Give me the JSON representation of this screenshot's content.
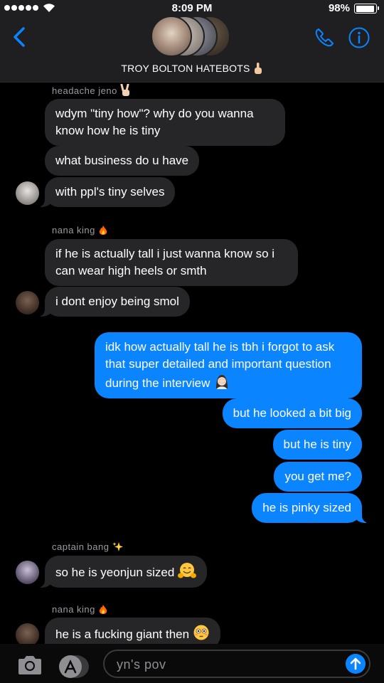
{
  "status_bar": {
    "time": "8:09 PM",
    "battery_text": "98%",
    "battery_level": 0.98
  },
  "header": {
    "group_name": "TROY BOLTON HATEBOTS",
    "group_name_emoji": "finger-pointing-up-emoji",
    "icons": [
      "back-chevron-icon",
      "phone-icon",
      "info-icon"
    ]
  },
  "messages": [
    {
      "sender": "headache jeno",
      "sender_emoji": "victory-hand-emoji"
    },
    {
      "direction": "in",
      "text_lines": [
        "wdym \"tiny how\"? why do you wanna",
        "know how he is tiny"
      ]
    },
    {
      "direction": "in",
      "text": "what business do u have"
    },
    {
      "direction": "in",
      "text": "with ppl's tiny selves"
    },
    {
      "sender": "nana king",
      "sender_emoji": "fire-emoji"
    },
    {
      "direction": "in",
      "text_lines": [
        "if he is actually tall i just wanna know so i",
        "can wear high heels or smth"
      ]
    },
    {
      "direction": "in",
      "text": "i dont enjoy being smol"
    },
    {
      "direction": "out",
      "text_lines": [
        "idk how actually tall he is tbh i forgot to ask",
        "that super detailed and important question",
        "during the interview"
      ],
      "emoji": "woman-facepalming-emoji"
    },
    {
      "direction": "out",
      "text": "but he looked a bit big"
    },
    {
      "direction": "out",
      "text": "but he is tiny"
    },
    {
      "direction": "out",
      "text": "you get me?"
    },
    {
      "direction": "out",
      "text": "he is pinky sized"
    },
    {
      "sender": "captain bang",
      "sender_emoji": "sparkles-emoji"
    },
    {
      "direction": "in",
      "text": "so he is yeonjun sized",
      "emoji": "hugging-face-emoji"
    },
    {
      "sender": "nana king",
      "sender_emoji": "fire-emoji"
    },
    {
      "direction": "in",
      "text": "he is a fucking giant then",
      "emoji": "flushed-face-emoji"
    }
  ],
  "input_bar": {
    "value": "yn's pov",
    "icons": [
      "camera-icon",
      "app-store-icon",
      "send-arrow-icon"
    ]
  },
  "colors": {
    "outgoing_bubble": "#0a84ff",
    "incoming_bubble": "#262629",
    "background": "#000000",
    "header": "#1f1f21",
    "accent": "#0a84ff"
  }
}
